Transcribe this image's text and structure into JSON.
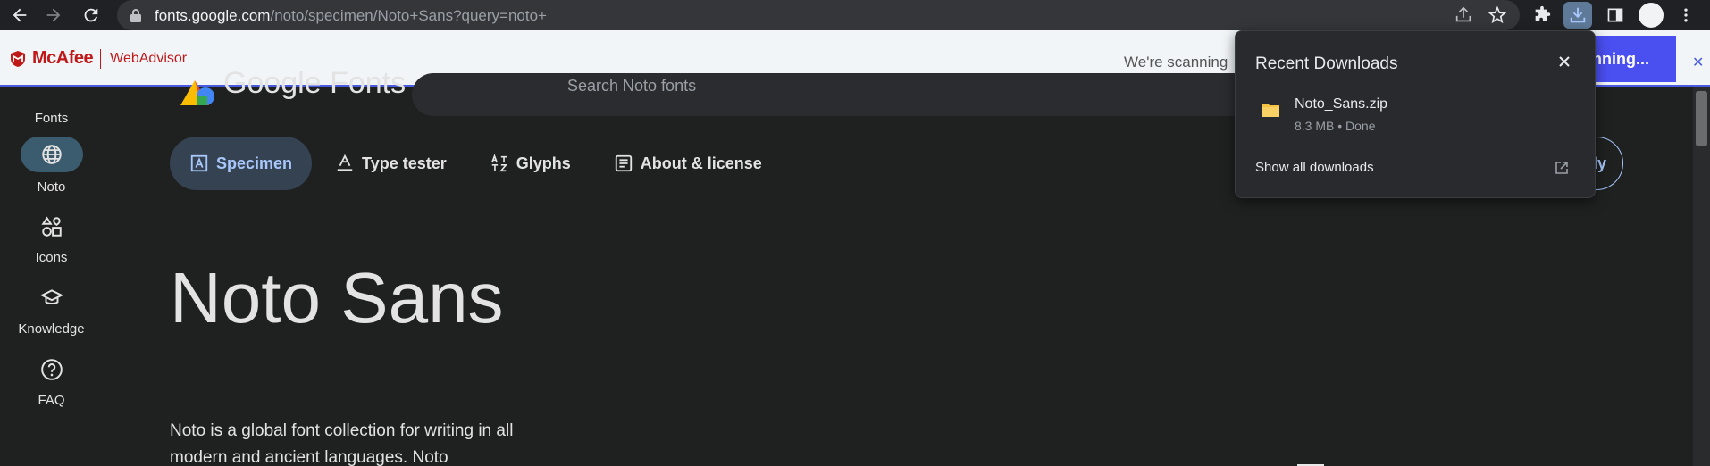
{
  "browser": {
    "url_host": "fonts.google.com",
    "url_path": "/noto/specimen/Noto+Sans?query=noto+"
  },
  "mcafee": {
    "brand": "McAfee",
    "product": "WebAdvisor",
    "status_text": "We're scanning",
    "scan_button_label": "nning..."
  },
  "rail": {
    "items": [
      {
        "label": "Fonts"
      },
      {
        "label": "Noto"
      },
      {
        "label": "Icons"
      },
      {
        "label": "Knowledge"
      },
      {
        "label": "FAQ"
      }
    ]
  },
  "header": {
    "logo_text": "Google Fonts",
    "search_placeholder": "Search Noto fonts"
  },
  "tabs": [
    {
      "label": "Specimen"
    },
    {
      "label": "Type tester"
    },
    {
      "label": "Glyphs"
    },
    {
      "label": "About & license"
    }
  ],
  "download_family_label": "ly",
  "specimen": {
    "title": "Noto Sans",
    "description": "Noto is a global font collection for writing in all modern and ancient languages. Noto"
  },
  "downloads": {
    "title": "Recent Downloads",
    "file_name": "Noto_Sans.zip",
    "file_meta": "8.3 MB • Done",
    "show_all": "Show all downloads"
  },
  "colors": {
    "accent": "#a8c7fa",
    "mcafee_red": "#c01818",
    "mcafee_blue": "#4a4ff0"
  }
}
